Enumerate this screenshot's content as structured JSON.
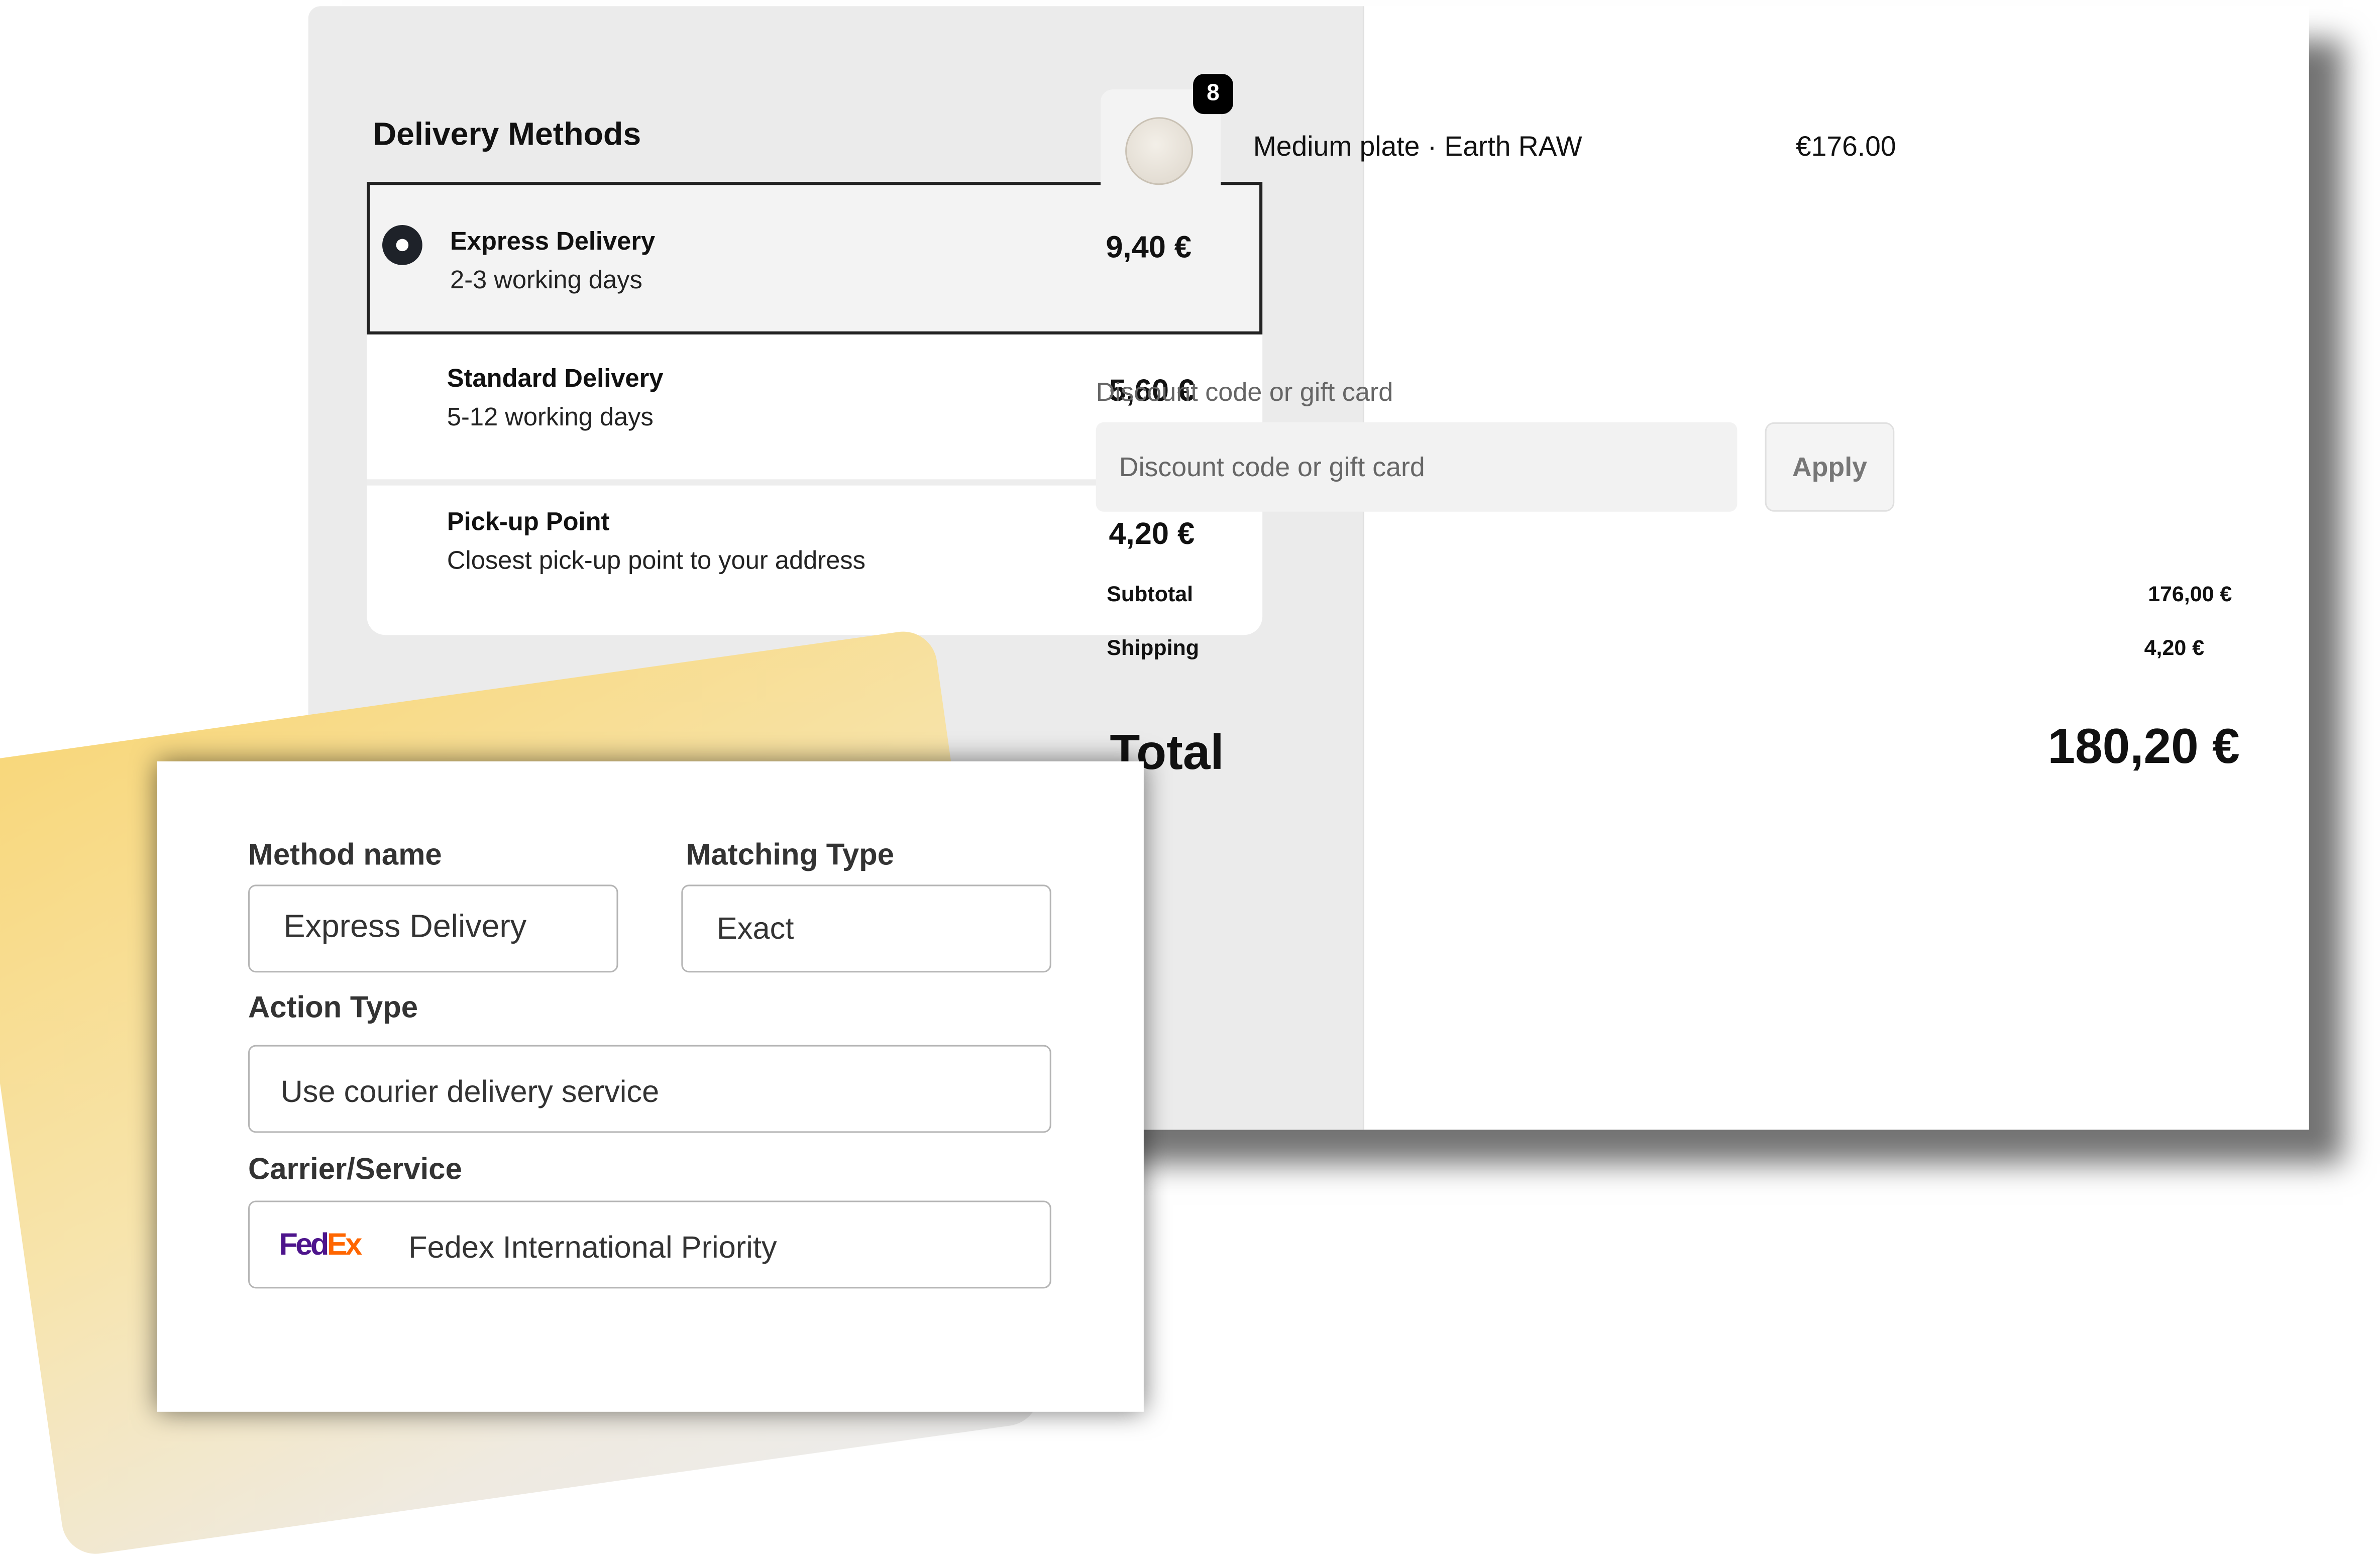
{
  "delivery": {
    "title": "Delivery Methods",
    "options": [
      {
        "name": "Express Delivery",
        "sub": "2-3 working days",
        "price": "9,40 €",
        "selected": true
      },
      {
        "name": "Standard Delivery",
        "sub": "5-12 working days",
        "price": "5,60 €",
        "selected": false
      },
      {
        "name": "Pick-up Point",
        "sub": "Closest pick-up point to your address",
        "price": "4,20 €",
        "selected": false
      }
    ]
  },
  "cart": {
    "item": {
      "quantity": "8",
      "name": "Medium plate · Earth RAW",
      "price": "€176.00"
    },
    "discount": {
      "label": "Discount code or gift card",
      "placeholder": "Discount code or gift card",
      "apply": "Apply"
    },
    "summary": {
      "subtotal_label": "Subtotal",
      "subtotal": "176,00 €",
      "shipping_label": "Shipping",
      "shipping": "4,20 €",
      "total_label": "Total",
      "total": "180,20 €"
    }
  },
  "form": {
    "method_name_label": "Method name",
    "method_name_value": "Express Delivery",
    "matching_type_label": "Matching Type",
    "matching_type_value": "Exact",
    "action_type_label": "Action Type",
    "action_type_value": "Use courier delivery service",
    "carrier_label": "Carrier/Service",
    "carrier_logo_fed": "Fed",
    "carrier_logo_ex": "Ex",
    "carrier_value": "Fedex International Priority"
  },
  "colors": {
    "fedex_purple": "#4d148c",
    "fedex_orange": "#ff6600",
    "accent_yellow": "#f8d77a"
  }
}
